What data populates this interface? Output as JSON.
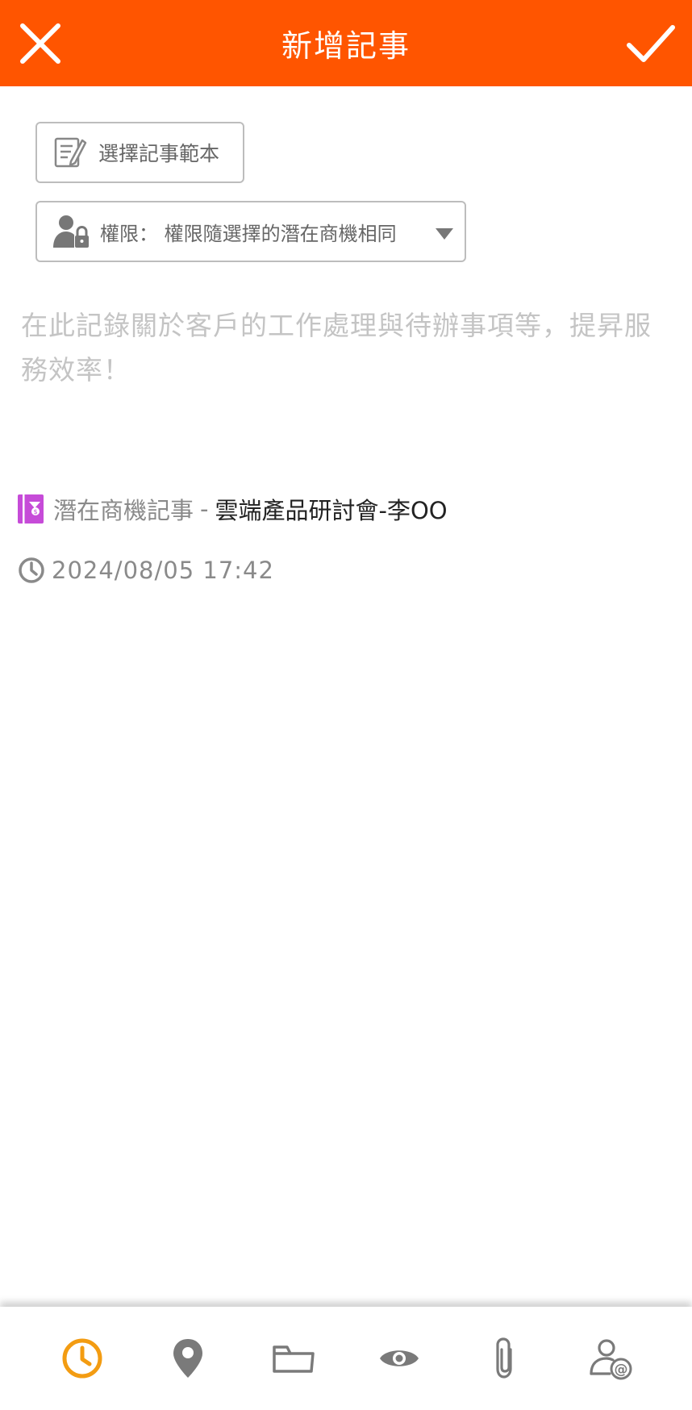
{
  "header": {
    "title": "新增記事",
    "background_color": "#FF5500",
    "close_icon": "close-icon",
    "confirm_icon": "check-icon"
  },
  "template_button": {
    "label": "選擇記事範本",
    "icon": "note-edit-icon"
  },
  "permission": {
    "label": "權限： 權限隨選擇的潛在商機相同",
    "icon": "user-lock-icon",
    "caret_icon": "caret-down-icon"
  },
  "note": {
    "value": "",
    "placeholder": "在此記錄關於客戶的工作處理與待辦事項等，提昇服務效率！"
  },
  "related": {
    "type_label": "潛在商機記事",
    "separator": "-",
    "name": "雲端產品研討會-李OO",
    "icon": "opportunity-book-icon",
    "icon_color": "#C64BD8"
  },
  "time": {
    "value": "2024/08/05 17:42",
    "icon": "clock-icon"
  },
  "toolbar": {
    "active_color": "#F39C12",
    "inactive_color": "#7a7a7a",
    "items": [
      "clock-icon",
      "location-pin-icon",
      "folder-icon",
      "eye-icon",
      "paperclip-icon",
      "mention-user-icon"
    ]
  }
}
